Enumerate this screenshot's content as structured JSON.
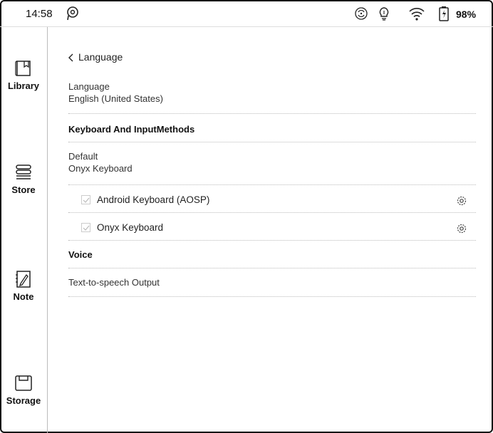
{
  "status": {
    "time": "14:58",
    "battery": "98%",
    "icons": [
      "p-logo-icon",
      "sync-icon",
      "bulb-icon",
      "wifi-icon",
      "battery-icon"
    ]
  },
  "sidebar": {
    "items": [
      {
        "label": "Library",
        "icon": "book-icon"
      },
      {
        "label": "Store",
        "icon": "stack-icon"
      },
      {
        "label": "Note",
        "icon": "pencil-note-icon"
      },
      {
        "label": "Storage",
        "icon": "folder-icon"
      }
    ]
  },
  "page": {
    "back_label": "Language",
    "language": {
      "title": "Language",
      "value": "English (United States)"
    },
    "keyboard_header": "Keyboard And InputMethods",
    "default": {
      "title": "Default",
      "value": "Onyx Keyboard"
    },
    "keyboards": [
      {
        "label": "Android Keyboard (AOSP)",
        "checked": true
      },
      {
        "label": "Onyx Keyboard",
        "checked": true
      }
    ],
    "voice_header": "Voice",
    "tts_label": "Text-to-speech Output"
  }
}
